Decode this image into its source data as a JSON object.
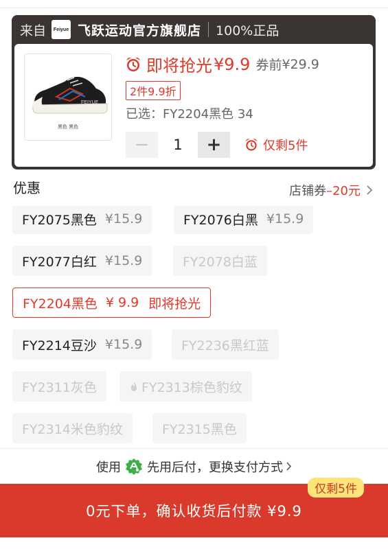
{
  "store": {
    "from_label": "来自",
    "logo_text": "Feiyue",
    "name": "飞跃运动官方旗舰店",
    "genuine": "100%正品"
  },
  "product": {
    "image_caption": "黑色  黑色",
    "flash_label": "即将抢光",
    "flash_price": "¥9.9",
    "before_label": "券前",
    "before_price": "¥29.9",
    "discount_tag": "2件9.9折",
    "selected": "已选：FY2204黑色 34",
    "quantity": "1",
    "minus_label": "−",
    "plus_label": "+",
    "stock_text": "仅剩5件"
  },
  "discount": {
    "title": "优惠",
    "coupon_label": "店铺券",
    "coupon_amount": "–20元"
  },
  "variants": [
    {
      "name": "FY2075黑色",
      "price": "¥15.9"
    },
    {
      "name": "FY2076白黑",
      "price": "¥15.9"
    },
    {
      "name": "FY2077白红",
      "price": "¥15.9"
    },
    {
      "name": "FY2078白蓝",
      "price": ""
    },
    {
      "name": "FY2204黑色",
      "price": "¥ 9.9",
      "status": "即将抢光"
    },
    {
      "name": "FY2214豆沙",
      "price": "¥15.9"
    },
    {
      "name": "FY2236黑红蓝",
      "price": ""
    },
    {
      "name": "FY2311灰色",
      "price": ""
    },
    {
      "name": "FY2313棕色豹纹",
      "price": ""
    },
    {
      "name": "FY2314米色豹纹",
      "price": ""
    },
    {
      "name": "FY2315黑色",
      "price": ""
    }
  ],
  "pay": {
    "prefix": "使用",
    "method": "先用后付，更换支付方式"
  },
  "buy": {
    "label": "0元下单，确认收货后付款 ¥9.9",
    "stock_badge": "仅剩5件"
  },
  "colors": {
    "accent": "#e0392b",
    "buy_bar": "#d93a2c",
    "badge_bg": "#fbe57a",
    "card_dark": "#3a3433"
  }
}
